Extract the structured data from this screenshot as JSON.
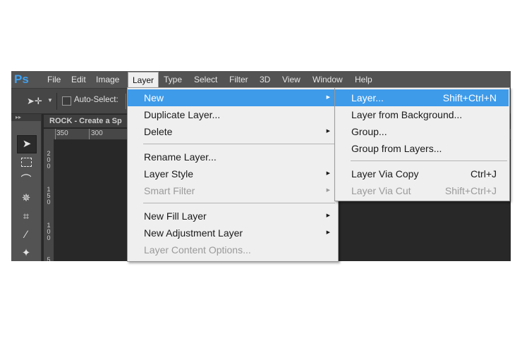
{
  "app": {
    "logo": "Ps"
  },
  "menubar": {
    "items": [
      "File",
      "Edit",
      "Image",
      "Layer",
      "Type",
      "Select",
      "Filter",
      "3D",
      "View",
      "Window",
      "Help"
    ],
    "active": "Layer"
  },
  "options_bar": {
    "auto_select_label": "Auto-Select:",
    "auto_select_checked": false
  },
  "document": {
    "tab_title": "ROCK - Create a Sp",
    "ruler_top": [
      "350",
      "300"
    ],
    "ruler_left": [
      "2",
      "0",
      "0",
      "1",
      "5",
      "0",
      "1",
      "0",
      "0",
      "5"
    ]
  },
  "layer_menu": {
    "new": "New",
    "duplicate": "Duplicate Layer...",
    "delete": "Delete",
    "rename": "Rename Layer...",
    "layer_style": "Layer Style",
    "smart_filter": "Smart Filter",
    "new_fill": "New Fill Layer",
    "new_adjustment": "New Adjustment Layer",
    "content_options": "Layer Content Options..."
  },
  "new_submenu": {
    "layer": "Layer...",
    "layer_shortcut": "Shift+Ctrl+N",
    "from_background": "Layer from Background...",
    "group": "Group...",
    "group_from_layers": "Group from Layers...",
    "via_copy": "Layer Via Copy",
    "via_copy_shortcut": "Ctrl+J",
    "via_cut": "Layer Via Cut",
    "via_cut_shortcut": "Shift+Ctrl+J"
  },
  "colors": {
    "highlight": "#3e9bea",
    "menu_bg": "#efefef",
    "ps_blue": "#3fa1f0"
  }
}
